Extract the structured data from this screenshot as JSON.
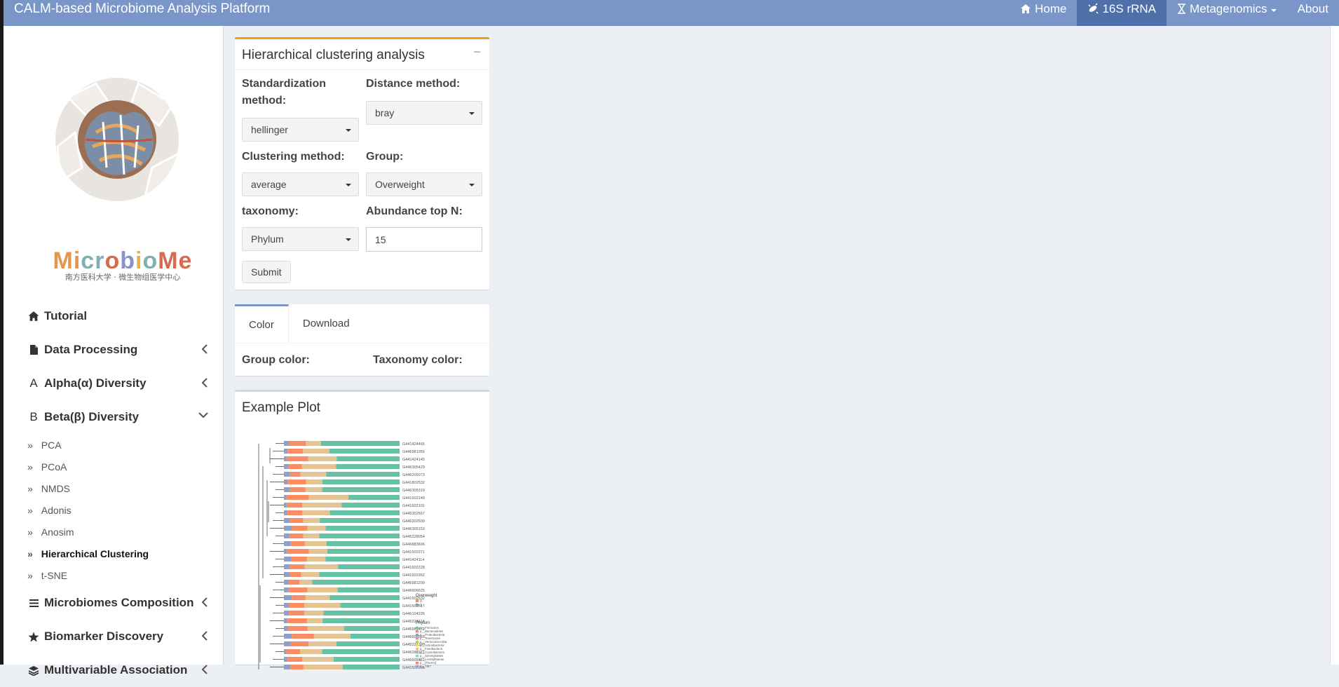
{
  "header": {
    "brand": "CALM-based Microbiome Analysis Platform",
    "nav": [
      {
        "label": "Home",
        "icon": "home-icon"
      },
      {
        "label": "16S rRNA",
        "icon": "bacteria-icon",
        "active": true
      },
      {
        "label": "Metagenomics",
        "icon": "hourglass-icon",
        "dropdown": true
      },
      {
        "label": "About"
      }
    ]
  },
  "sidebar": {
    "logo_word": "MicrobioMe",
    "logo_sub": "南方医科大学 · 微生物组医学中心",
    "menu": [
      {
        "label": "Tutorial",
        "icon": "home-icon"
      },
      {
        "label": "Data Processing",
        "icon": "file-icon"
      },
      {
        "label": "Alpha(α) Diversity",
        "icon": "alpha-icon"
      },
      {
        "label": "Beta(β) Diversity",
        "icon": "beta-icon",
        "expanded": true
      }
    ],
    "submenu": [
      "PCA",
      "PCoA",
      "NMDS",
      "Adonis",
      "Anosim",
      "Hierarchical Clustering",
      "t-SNE"
    ],
    "menu_after": [
      {
        "label": "Microbiomes Composition",
        "icon": "bars-icon"
      },
      {
        "label": "Biomarker Discovery",
        "icon": "star-icon"
      },
      {
        "label": "Multivariable Association",
        "icon": "layers-icon"
      }
    ]
  },
  "panel": {
    "title": "Hierarchical clustering analysis",
    "standardization_label": "Standardization method:",
    "standardization_value": "hellinger",
    "distance_label": "Distance method:",
    "distance_value": "bray",
    "clustering_label": "Clustering method:",
    "clustering_value": "average",
    "group_label": "Group:",
    "group_value": "Overweight",
    "taxonomy_label": "taxonomy:",
    "taxonomy_value": "Phylum",
    "topn_label": "Abundance top N:",
    "topn_value": "15",
    "submit_label": "Submit"
  },
  "tabs": {
    "color_tab": "Color",
    "download_tab": "Download",
    "group_color_label": "Group color:",
    "taxonomy_color_label": "Taxonomy color:"
  },
  "example": {
    "title": "Example Plot",
    "sample_ids": [
      "G441424465",
      "G446981356",
      "G441424145",
      "G446305429",
      "G446205073",
      "G441802532",
      "G446305319",
      "G441502149",
      "G441502101",
      "G445302567",
      "G446302509",
      "G446305153",
      "G445228054",
      "G446883606",
      "G441502371",
      "G441424114",
      "G441502228",
      "G441502362",
      "G446981209",
      "G446606625",
      "G441502532",
      "G441502517",
      "G446104226",
      "G445224214",
      "G446981472",
      "G446606563",
      "G445224190",
      "G446282121",
      "G446606421",
      "G441502205"
    ],
    "legend_group_title": "Overweight",
    "legend_groups": [
      "0",
      "1"
    ],
    "legend_taxa_title": "Phylum",
    "legend_taxa": [
      "p__Firmicutes",
      "p__Bacteroidetes",
      "p__Proteobacteria",
      "p__Tenericutes",
      "p__Verrucomicrobia",
      "p__Actinobacteria",
      "p__Fusobacteria",
      "p__Cyanobacteria",
      "p__Synergistetes",
      "p__Lentisphaerae",
      "p__[Thermi]",
      "p__TM7"
    ],
    "colors": {
      "accent": "#7a96c9",
      "brand_orange": "#f39c12",
      "firmicutes": "#66c2a5",
      "bacteroidetes": "#fc8d62",
      "proteobacteria": "#8da0cb",
      "tenericutes": "#e5c494"
    }
  }
}
